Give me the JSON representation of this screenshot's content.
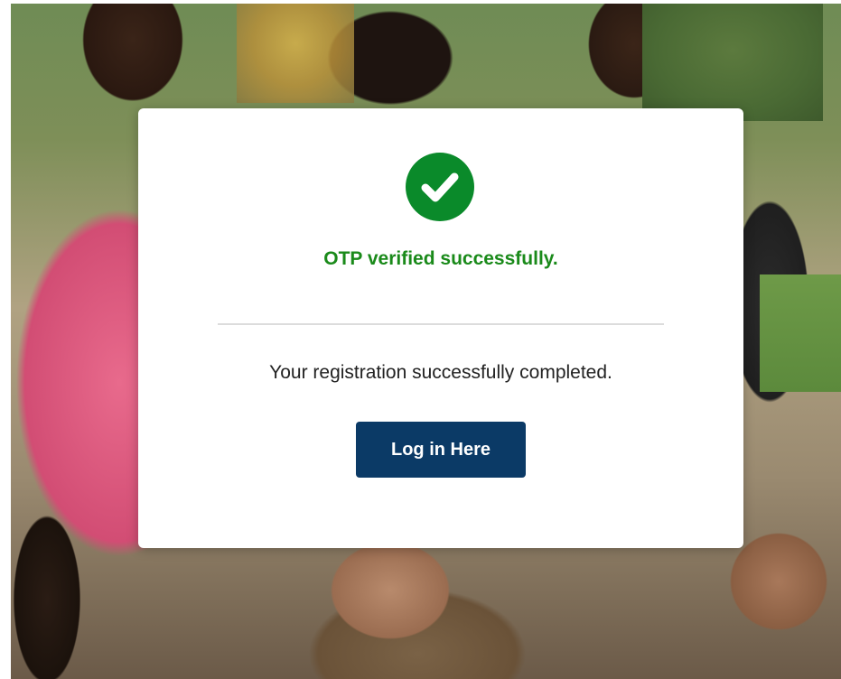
{
  "modal": {
    "success_message": "OTP verified successfully.",
    "registration_message": "Your registration successfully completed.",
    "login_button_label": "Log in Here",
    "icon": "check-circle-icon"
  },
  "colors": {
    "success_green": "#0a8a2a",
    "success_text": "#1a8a1a",
    "button_bg": "#0b3a66",
    "button_text": "#ffffff"
  }
}
